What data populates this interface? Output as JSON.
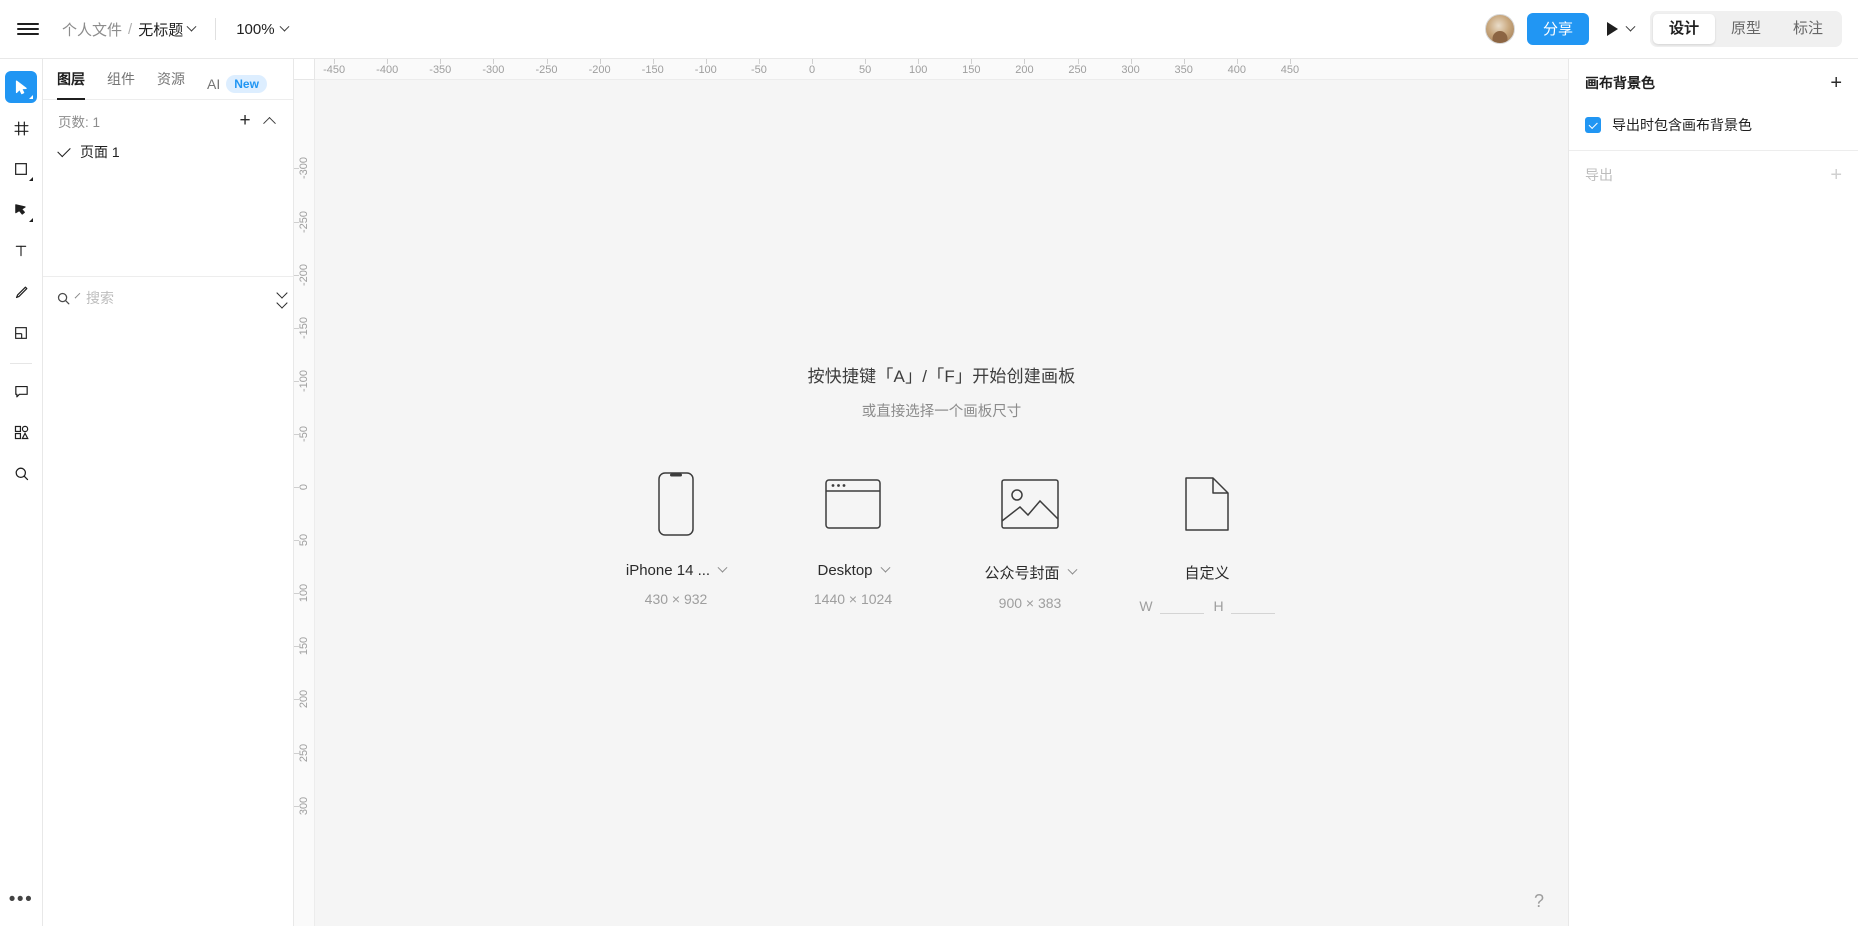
{
  "header": {
    "menu_icon": "hamburger-icon",
    "breadcrumb": {
      "folder": "个人文件",
      "separator": "/",
      "name": "无标题"
    },
    "zoom": "100%",
    "share_label": "分享",
    "tabs": [
      {
        "label": "设计",
        "active": true
      },
      {
        "label": "原型",
        "active": false
      },
      {
        "label": "标注",
        "active": false
      }
    ]
  },
  "toolbar": {
    "items": [
      {
        "name": "move-cursor-tool",
        "active": true
      },
      {
        "name": "frame-tool",
        "active": false
      },
      {
        "name": "rectangle-tool",
        "active": false
      },
      {
        "name": "pen-tool",
        "active": false
      },
      {
        "name": "text-tool",
        "active": false
      },
      {
        "name": "pencil-tool",
        "active": false
      },
      {
        "name": "slice-tool",
        "active": false
      },
      {
        "name": "comment-tool",
        "active": false
      },
      {
        "name": "plugin-tool",
        "active": false
      },
      {
        "name": "search-tool",
        "active": false
      }
    ],
    "more_label": "•••"
  },
  "left_panel": {
    "tabs": [
      {
        "label": "图层",
        "active": true
      },
      {
        "label": "组件",
        "active": false
      },
      {
        "label": "资源",
        "active": false
      }
    ],
    "ai_tab": {
      "label": "AI",
      "badge": "New"
    },
    "pages_label": "页数: 1",
    "pages": [
      {
        "label": "页面 1",
        "selected": true
      }
    ],
    "search_placeholder": "搜索",
    "search_value": ""
  },
  "canvas": {
    "empty_title": "按快捷键「A」/「F」开始创建画板",
    "empty_subtitle": "或直接选择一个画板尺寸",
    "presets": [
      {
        "name": "iPhone 14 ...",
        "size": "430 × 932",
        "icon": "phone-icon",
        "has_dropdown": true
      },
      {
        "name": "Desktop",
        "size": "1440 × 1024",
        "icon": "browser-window-icon",
        "has_dropdown": true
      },
      {
        "name": "公众号封面",
        "size": "900 × 383",
        "icon": "image-icon",
        "has_dropdown": true
      },
      {
        "name": "自定义",
        "size": "",
        "icon": "document-icon",
        "has_dropdown": false,
        "width_label": "W",
        "height_label": "H",
        "width_value": "",
        "height_value": ""
      }
    ],
    "ruler_h_labels": [
      "-450",
      "-400",
      "-350",
      "-300",
      "-250",
      "-200",
      "-150",
      "-100",
      "-50",
      "0",
      "50",
      "100",
      "150",
      "200",
      "250",
      "300",
      "350",
      "400",
      "450"
    ],
    "ruler_v_labels": [
      "-300",
      "-250",
      "-200",
      "-150",
      "-100",
      "-50",
      "0",
      "50",
      "100",
      "150",
      "200",
      "250",
      "300"
    ],
    "help_label": "?"
  },
  "right_panel": {
    "background_title": "画布背景色",
    "background_checkbox_label": "导出时包含画布背景色",
    "background_checked": true,
    "export_title": "导出"
  },
  "colors": {
    "accent": "#2196f3",
    "canvas_bg": "#f5f5f5",
    "panel_bg": "#ffffff",
    "text": "#1f1f1f",
    "muted": "#8c8c8c"
  }
}
